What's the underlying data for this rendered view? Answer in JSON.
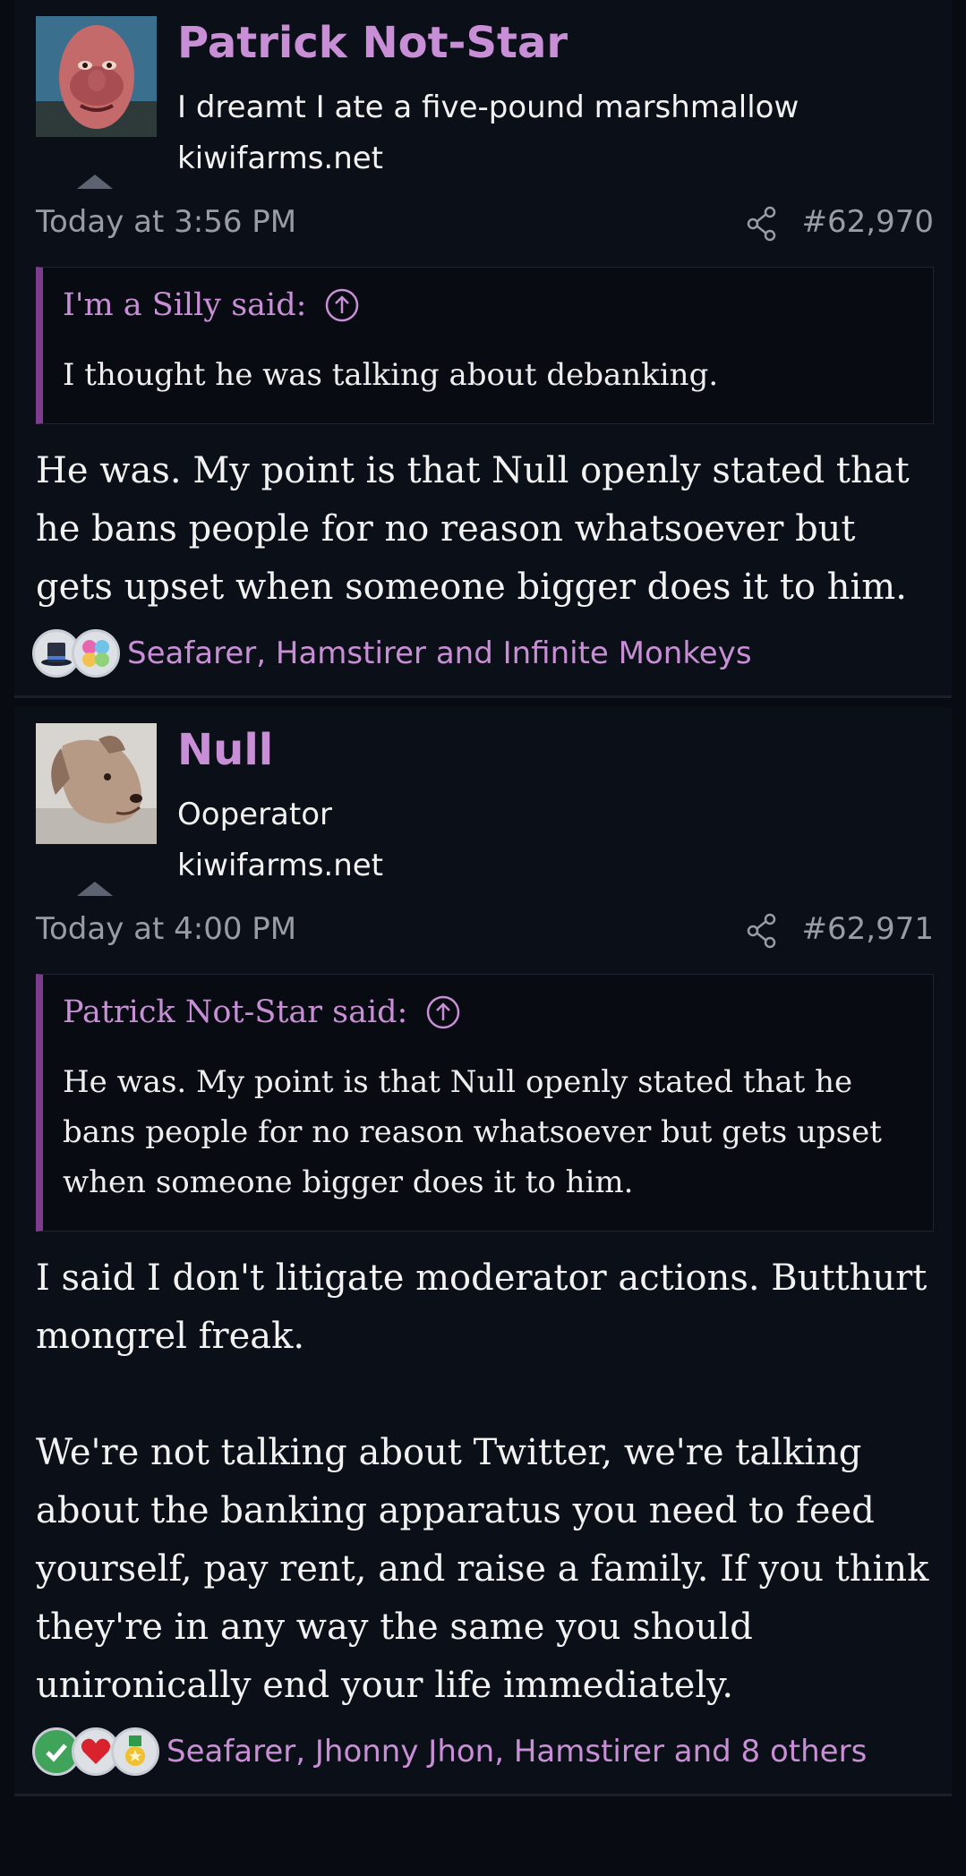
{
  "colors": {
    "background": "#080b12",
    "post_background": "#0b0f17",
    "accent": "#c98fd6",
    "quote_border": "#7d3c8c",
    "muted_text": "#9a9ca4"
  },
  "posts": [
    {
      "username": "Patrick Not-Star",
      "user_title": "I dreamt I ate a five-pound marshmallow",
      "user_site": "kiwifarms.net",
      "date": "Today at 3:56 PM",
      "post_number": "#62,970",
      "quote": {
        "author": "I'm a Silly said:",
        "text": "I thought he was talking about debanking."
      },
      "body": [
        "He was. My point is that Null openly stated that he bans people for no reason whatsoever but gets upset when someone bigger does it to him."
      ],
      "reaction_icons": [
        "top-hat-icon",
        "puzzle-icon"
      ],
      "reaction_users": "Seafarer, Hamstirer and Infinite Monkeys"
    },
    {
      "username": "Null",
      "user_title": "Ooperator",
      "user_site": "kiwifarms.net",
      "date": "Today at 4:00 PM",
      "post_number": "#62,971",
      "quote": {
        "author": "Patrick Not-Star said:",
        "text": "He was. My point is that Null openly stated that he bans people for no reason whatsoever but gets upset when someone bigger does it to him."
      },
      "body": [
        "I said I don't litigate moderator actions. Butthurt mongrel freak.",
        "We're not talking about Twitter, we're talking about the banking apparatus you need to feed yourself, pay rent, and raise a family. If you think they're in any way the same you should unironically end your life immediately."
      ],
      "reaction_icons": [
        "checkmark-icon",
        "heart-icon",
        "medal-icon"
      ],
      "reaction_users": "Seafarer, Jhonny Jhon, Hamstirer and 8 others"
    }
  ]
}
